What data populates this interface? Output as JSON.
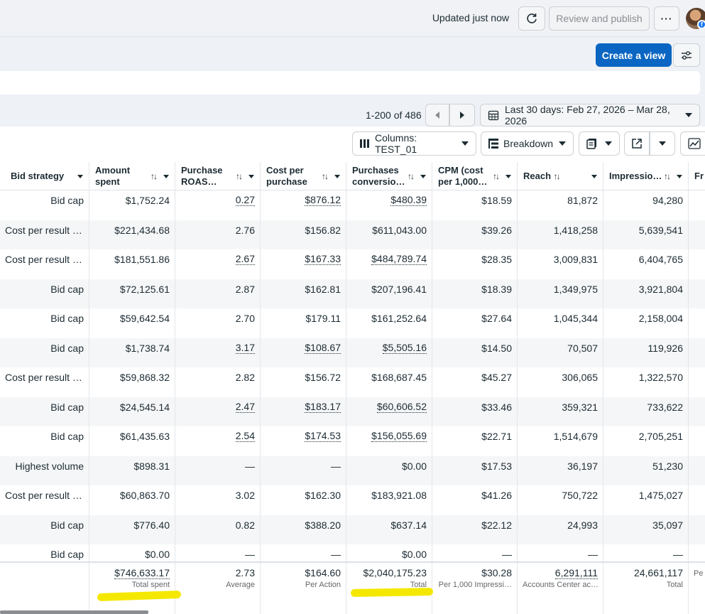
{
  "topbar": {
    "updated_text": "Updated just now",
    "review_label": "Review and publish",
    "more_label": "···"
  },
  "actions": {
    "create_view_label": "Create a view"
  },
  "pagination": {
    "range_text": "1-200 of 486",
    "date_range_label": "Last 30 days: Feb 27, 2026 – Mar 28, 2026"
  },
  "toolbar": {
    "columns_label": "Columns: TEST_01",
    "breakdown_label": "Breakdown"
  },
  "table": {
    "headers": {
      "bid": "Bid strategy",
      "amount": [
        "Amount",
        "spent"
      ],
      "roas": [
        "Purchase",
        "ROAS…"
      ],
      "cpp": [
        "Cost per",
        "purchase"
      ],
      "conv": [
        "Purchases",
        "conversio…"
      ],
      "cpm": [
        "CPM (cost",
        "per 1,000…"
      ],
      "reach": "Reach",
      "impr": "Impressio…",
      "freq": "Fr"
    },
    "rows": [
      [
        "Bid cap",
        "$1,752.24",
        "0.27",
        "$876.12",
        "$480.39",
        "$18.59",
        "81,872",
        "94,280"
      ],
      [
        "Cost per result …",
        "$221,434.68",
        "2.76",
        "$156.82",
        "$611,043.00",
        "$39.26",
        "1,418,258",
        "5,639,541"
      ],
      [
        "Cost per result …",
        "$181,551.86",
        "2.67",
        "$167.33",
        "$484,789.74",
        "$28.35",
        "3,009,831",
        "6,404,765"
      ],
      [
        "Bid cap",
        "$72,125.61",
        "2.87",
        "$162.81",
        "$207,196.41",
        "$18.39",
        "1,349,975",
        "3,921,804"
      ],
      [
        "Bid cap",
        "$59,642.54",
        "2.70",
        "$179.11",
        "$161,252.64",
        "$27.64",
        "1,045,344",
        "2,158,004"
      ],
      [
        "Bid cap",
        "$1,738.74",
        "3.17",
        "$108.67",
        "$5,505.16",
        "$14.50",
        "70,507",
        "119,926"
      ],
      [
        "Cost per result …",
        "$59,868.32",
        "2.82",
        "$156.72",
        "$168,687.45",
        "$45.27",
        "306,065",
        "1,322,570"
      ],
      [
        "Bid cap",
        "$24,545.14",
        "2.47",
        "$183.17",
        "$60,606.52",
        "$33.46",
        "359,321",
        "733,622"
      ],
      [
        "Bid cap",
        "$61,435.63",
        "2.54",
        "$174.53",
        "$156,055.69",
        "$22.71",
        "1,514,679",
        "2,705,251"
      ],
      [
        "Highest volume",
        "$898.31",
        "—",
        "—",
        "$0.00",
        "$17.53",
        "36,197",
        "51,230"
      ],
      [
        "Cost per result …",
        "$60,863.70",
        "3.02",
        "$162.30",
        "$183,921.08",
        "$41.26",
        "750,722",
        "1,475,027"
      ],
      [
        "Bid cap",
        "$776.40",
        "0.82",
        "$388.20",
        "$637.14",
        "$22.12",
        "24,993",
        "35,097"
      ],
      [
        "Bid cap",
        "$0.00",
        "—",
        "—",
        "$0.00",
        "—",
        "—",
        "—"
      ]
    ],
    "footer": {
      "amount": {
        "value": "$746,633.17",
        "sub": "Total spent"
      },
      "roas": {
        "value": "2.73",
        "sub": "Average"
      },
      "cpp": {
        "value": "$164.60",
        "sub": "Per Action"
      },
      "conv": {
        "value": "$2,040,175.23",
        "sub": "Total"
      },
      "cpm": {
        "value": "$30.28",
        "sub": "Per 1,000 Impressi…"
      },
      "reach": {
        "value": "6,291,111",
        "sub": "Accounts Center ac…"
      },
      "impr": {
        "value": "24,661,117",
        "sub": "Total"
      },
      "freq": {
        "value": "",
        "sub": "Pe"
      }
    }
  },
  "colors": {
    "primary": "#0a66c2",
    "highlight": "#f5e800",
    "alt_row": "#f5f6f7"
  },
  "icons": [
    "refresh-icon",
    "sliders-icon",
    "chevron-left-icon",
    "chevron-right-icon",
    "calendar-icon",
    "columns-icon",
    "breakdown-icon",
    "reports-icon",
    "export-icon",
    "chart-icon"
  ]
}
